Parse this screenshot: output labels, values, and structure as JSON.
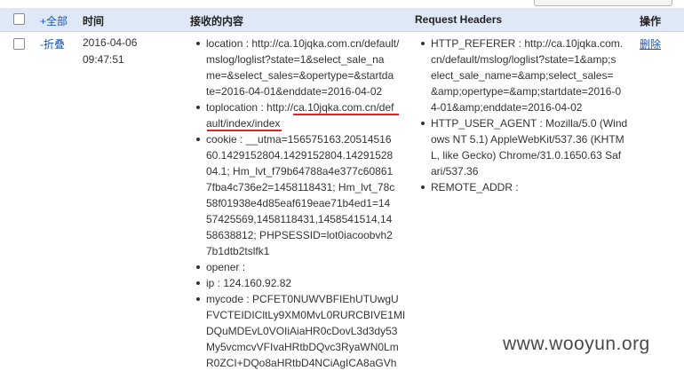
{
  "header": {
    "select_all": "+全部",
    "time": "时间",
    "received": "接收的内容",
    "request_headers": "Request Headers",
    "actions": "操作"
  },
  "row": {
    "collapse": "-折叠",
    "date": "2016-04-06",
    "time": "09:47:51",
    "delete": "删除",
    "received_items": [
      {
        "lines": [
          "location : http://ca.10jqka.com.cn/default/",
          "mslog/loglist?state=1&select_sale_na",
          "me=&select_sales=&opertype=&startda",
          "te=2016-04-01&enddate=2016-04-02"
        ]
      },
      {
        "lines": [
          "toplocation : http://ca.10jqka.com.cn/def",
          "ault/index/index"
        ]
      },
      {
        "lines": [
          "cookie : __utma=156575163.20514516",
          "60.1429152804.1429152804.14291528",
          "04.1; Hm_lvt_f79b64788a4e377c60861",
          "7fba4c736e2=1458118431; Hm_lvt_78c",
          "58f01938e4d85eaf619eae71b4ed1=14",
          "57425569,1458118431,1458541514,14",
          "58638812; PHPSESSID=lot0iacoobvh2",
          "7b1dtb2tslfk1"
        ]
      },
      {
        "lines": [
          "opener :"
        ]
      },
      {
        "lines": [
          "ip : 124.160.92.82"
        ]
      },
      {
        "lines": [
          "mycode : PCFET0NUWVBFIEhUTUwgU",
          "FVCTEIDICltLy9XM0MvL0RURCBIVE1MI",
          "DQuMDEvL0VOIiAiaHR0cDovL3d3dy53",
          "My5vcmcvVFIvaHRtbDQvc3RyaWN0Lm",
          "R0ZCI+DQo8aHRtbD4NCiAgICA8aGVh"
        ]
      }
    ],
    "header_items": [
      {
        "lines": [
          "HTTP_REFERER : http://ca.10jqka.com.",
          "cn/default/mslog/loglist?state=1&amp;s",
          "elect_sale_name=&amp;select_sales=",
          "&amp;opertype=&amp;startdate=2016-0",
          "4-01&amp;enddate=2016-04-02"
        ]
      },
      {
        "lines": [
          "HTTP_USER_AGENT : Mozilla/5.0 (Wind",
          "ows NT 5.1) AppleWebKit/537.36 (KHTM",
          "L, like Gecko) Chrome/31.0.1650.63 Saf",
          "ari/537.36"
        ]
      },
      {
        "lines": [
          "REMOTE_ADDR :"
        ]
      }
    ]
  },
  "watermark": "www.wooyun.org",
  "colors": {
    "header_bg": "#dfe8f6",
    "link": "#1a56b8",
    "highlight_underline": "#e02424"
  }
}
